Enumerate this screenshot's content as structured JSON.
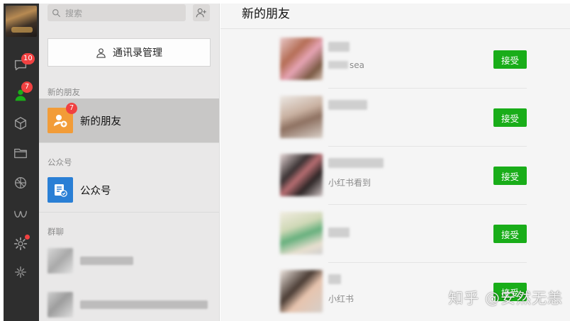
{
  "rail": {
    "chats_badge": "10",
    "contacts_badge": "7",
    "icons": [
      "chat-icon",
      "contacts-icon",
      "favorites-cube-icon",
      "folder-icon",
      "moments-icon",
      "mini-program-icon",
      "settings-gear-icon",
      "channels-icon"
    ]
  },
  "search": {
    "placeholder": "搜索"
  },
  "contacts_manage": {
    "label": "通讯录管理"
  },
  "sections": {
    "new_friends_header": "新的朋友",
    "official_header": "公众号",
    "groups_header": "群聊"
  },
  "new_friends_item": {
    "label": "新的朋友",
    "badge": "7"
  },
  "official_item": {
    "label": "公众号"
  },
  "main": {
    "title": "新的朋友",
    "requests": [
      {
        "subtitle": "sea",
        "button": "接受"
      },
      {
        "subtitle": "",
        "button": "接受"
      },
      {
        "subtitle": "小红书看到",
        "button": "接受"
      },
      {
        "subtitle": "",
        "button": "接受"
      },
      {
        "subtitle": "小红书",
        "button": "接受"
      }
    ]
  },
  "watermark": "知乎 @安然无恙",
  "colors": {
    "accept_green": "#19ad19",
    "badge_red": "#f04141",
    "rail_dark": "#2e2e2e",
    "contacts_green": "#1aad19"
  }
}
